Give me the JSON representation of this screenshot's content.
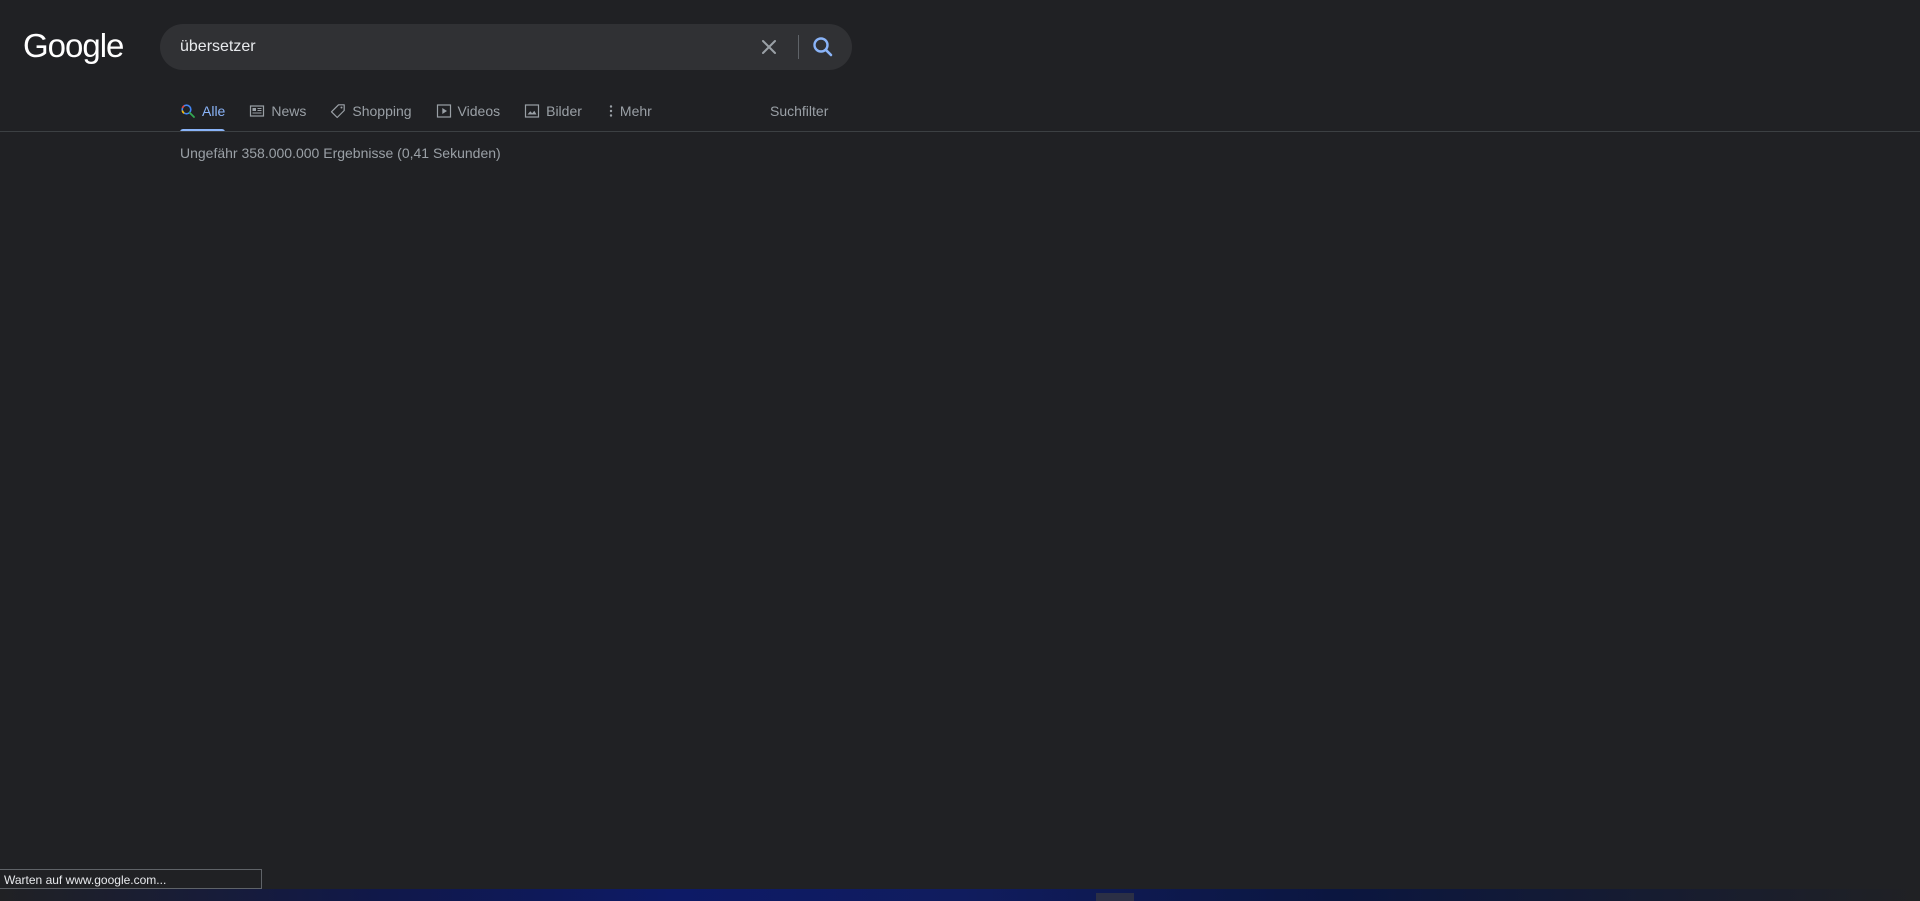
{
  "logo": {
    "text": "Google",
    "color": "#ffffff"
  },
  "search": {
    "value": "übersetzer",
    "clear_icon": "close-icon",
    "search_icon": "search-icon",
    "search_icon_color": "#8ab4f8"
  },
  "tabs": [
    {
      "label": "Alle",
      "icon": "search-icon",
      "active": true
    },
    {
      "label": "News",
      "icon": "news-icon",
      "active": false
    },
    {
      "label": "Shopping",
      "icon": "tag-icon",
      "active": false
    },
    {
      "label": "Videos",
      "icon": "play-icon",
      "active": false
    },
    {
      "label": "Bilder",
      "icon": "image-icon",
      "active": false
    },
    {
      "label": "Mehr",
      "icon": "more-vertical-icon",
      "active": false
    }
  ],
  "tools": {
    "label": "Suchfilter"
  },
  "results": {
    "stats": "Ungefähr 358.000.000 Ergebnisse (0,41 Sekunden)"
  },
  "status": {
    "text": "Warten auf www.google.com..."
  },
  "colors": {
    "background": "#202124",
    "searchbox": "#303134",
    "accent": "#8ab4f8",
    "muted_text": "#9aa0a6"
  }
}
